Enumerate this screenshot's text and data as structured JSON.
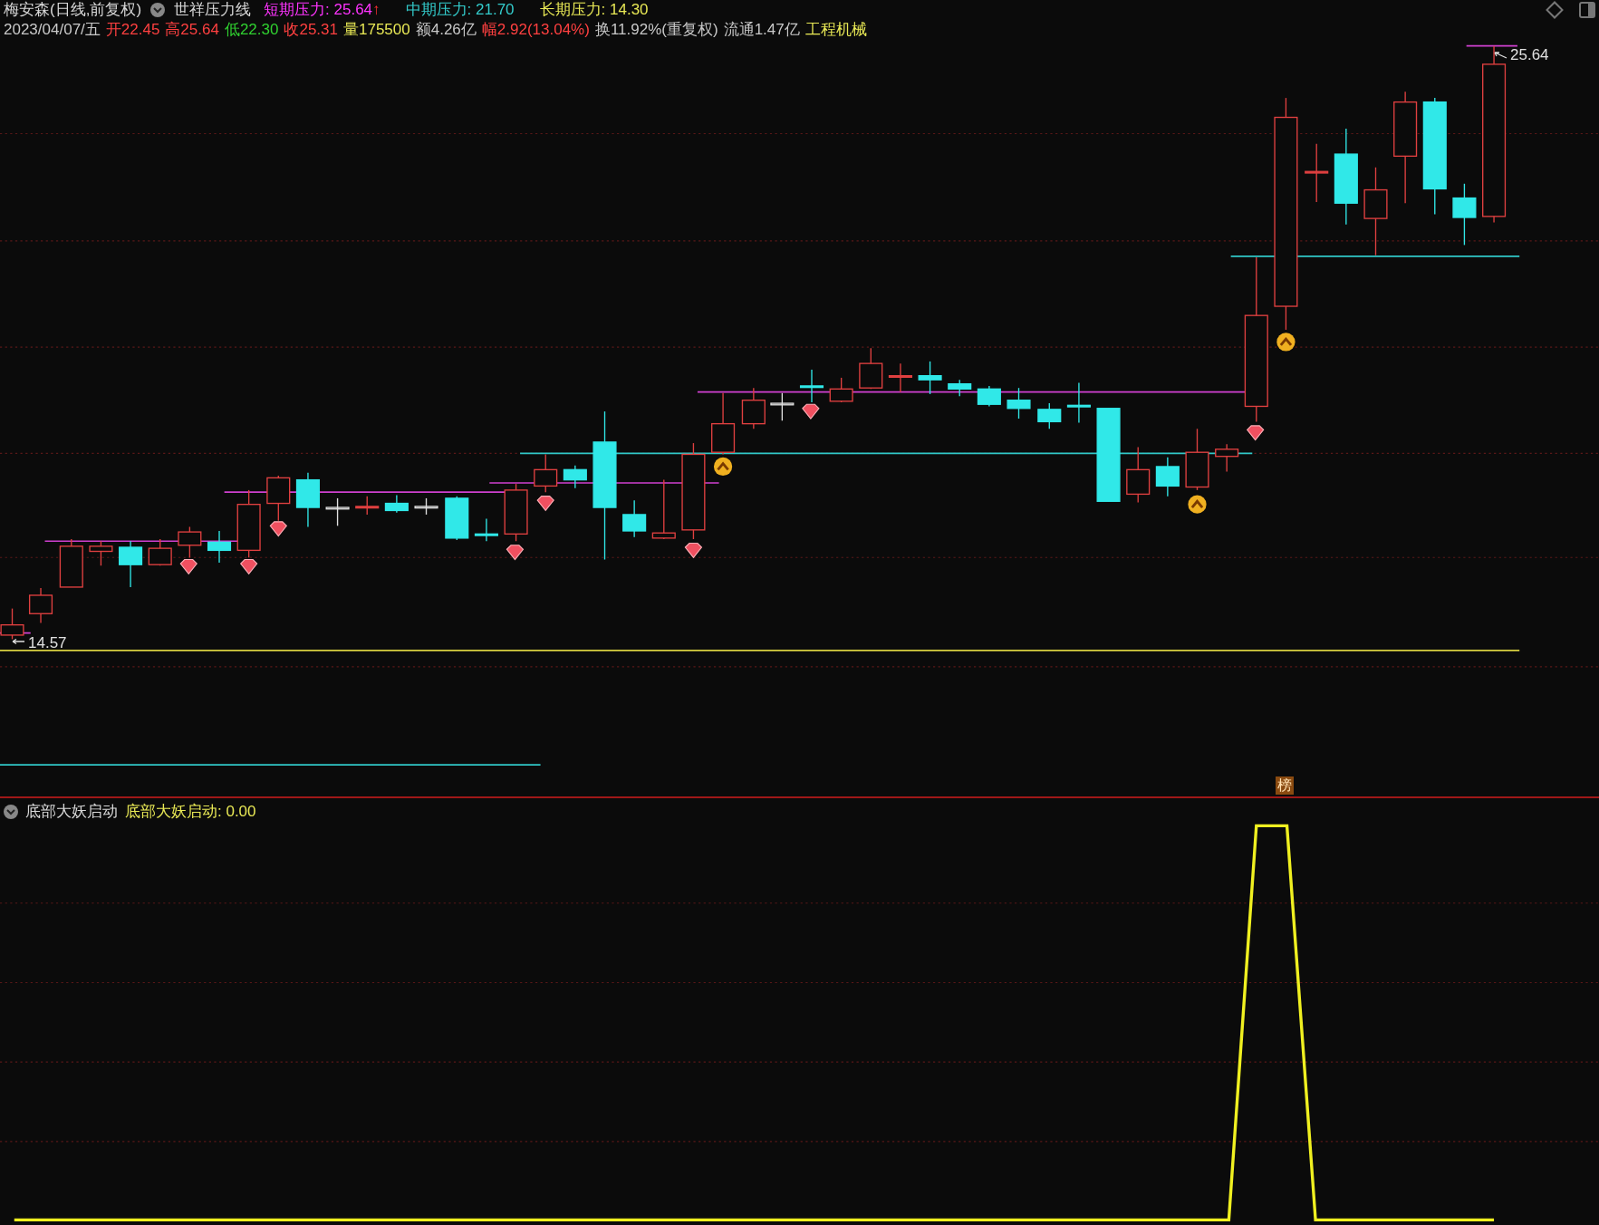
{
  "stock_title": "梅安森(日线,前复权)",
  "main_indicator": {
    "name": "世祥压力线",
    "readings": [
      {
        "text": "短期压力: 25.64",
        "color": "#ff33ff",
        "arrow": "↑"
      },
      {
        "text": "中期压力: 21.70",
        "color": "#33cccc"
      },
      {
        "text": "长期压力: 14.30",
        "color": "#e8e855"
      }
    ]
  },
  "quote": [
    {
      "text": "2023/04/07/五",
      "color": "#c8c8c8"
    },
    {
      "text": "开22.45",
      "color": "#ff4040"
    },
    {
      "text": "高25.64",
      "color": "#ff4040"
    },
    {
      "text": "低22.30",
      "color": "#30d030"
    },
    {
      "text": "收25.31",
      "color": "#ff4040"
    },
    {
      "text": "量175500",
      "color": "#e8e855"
    },
    {
      "text": "额4.26亿",
      "color": "#c8c8c8"
    },
    {
      "text": "幅2.92(13.04%)",
      "color": "#ff4040"
    },
    {
      "text": "换11.92%(重复权)",
      "color": "#c8c8c8"
    },
    {
      "text": "流通1.47亿",
      "color": "#c8c8c8"
    },
    {
      "text": "工程机械",
      "color": "#e8e855"
    }
  ],
  "price_labels": {
    "high": "25.64",
    "low": "14.57"
  },
  "badge": "榜",
  "lower_panel": {
    "name": "底部大妖启动",
    "reading": {
      "text": "底部大妖启动: 0.00",
      "color": "#e8e855"
    }
  }
}
